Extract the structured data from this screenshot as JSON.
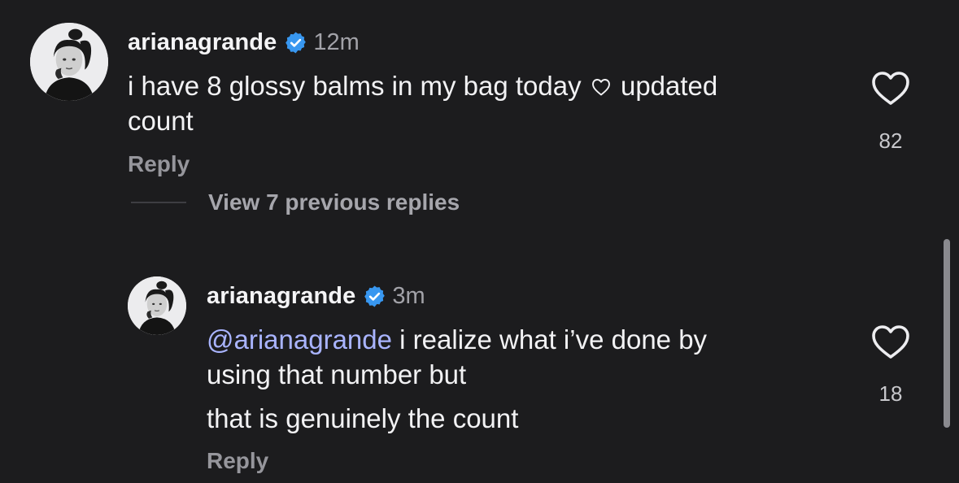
{
  "comments": [
    {
      "username": "arianagrande",
      "time": "12m",
      "text_line1": "i have 8 glossy balms in my bag today",
      "text_line1_tail": "updated",
      "text_line2": "count",
      "reply_label": "Reply",
      "like_count": "82"
    },
    {
      "username": "arianagrande",
      "time": "3m",
      "mention": "@arianagrande",
      "text_line1": " i realize what i’ve done by",
      "text_line2": "using that number but",
      "text_line3": "that is genuinely the count",
      "reply_label": "Reply",
      "like_count": "18"
    }
  ],
  "thread": {
    "view_replies_label": "View 7 previous replies"
  },
  "icons": {
    "verified": "verified-badge-icon",
    "like": "heart-outline-icon",
    "inline_heart": "heart-outline-icon"
  },
  "colors": {
    "background": "#1c1c1e",
    "verified_blue": "#3897f0",
    "mention": "#a9b4ff",
    "secondary_text": "#96969c"
  }
}
